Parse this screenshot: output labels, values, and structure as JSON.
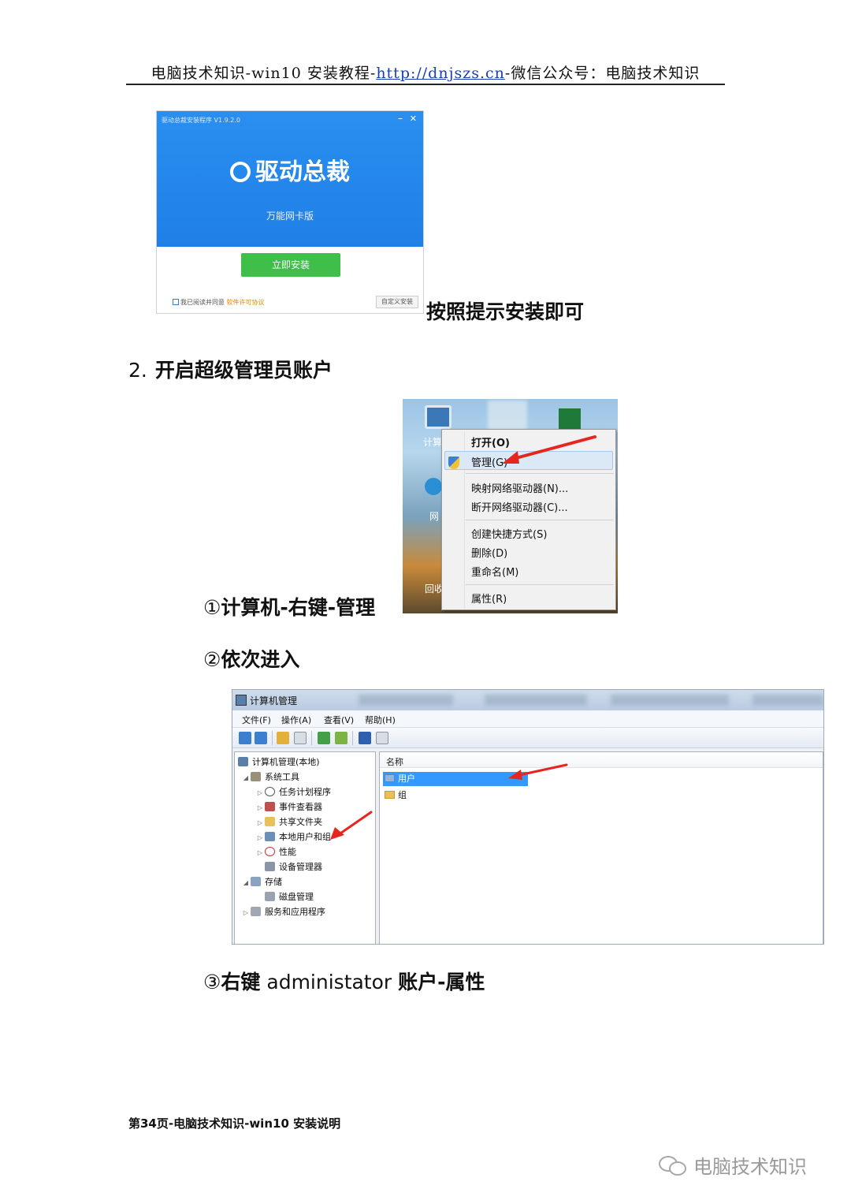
{
  "header": {
    "prefix": "电脑技术知识-win10 安装教程-",
    "link": "http://dnjszs.cn",
    "suffix": "-微信公众号：电脑技术知识"
  },
  "installer": {
    "window_title": "驱动总裁安装程序 V1.9.2.0",
    "brand": "驱动总裁",
    "subtitle": "万能网卡版",
    "install_button": "立即安装",
    "agree_text": "我已阅读并同意",
    "license_link": "软件许可协议",
    "custom_button": "自定义安装"
  },
  "caption_install": "按照提示安装即可",
  "section2": {
    "number": "2.",
    "title": "开启超级管理员账户"
  },
  "context_menu": {
    "desktop_labels": [
      "计算",
      "网",
      "回收"
    ],
    "items": [
      "打开(O)",
      "管理(G)",
      "映射网络驱动器(N)...",
      "断开网络驱动器(C)...",
      "创建快捷方式(S)",
      "删除(D)",
      "重命名(M)",
      "属性(R)"
    ]
  },
  "step1": {
    "marker": "①",
    "text": "计算机-右键-管理"
  },
  "step2": {
    "marker": "②",
    "text": "依次进入"
  },
  "mmc": {
    "title": "计算机管理",
    "menus": [
      "文件(F)",
      "操作(A)",
      "查看(V)",
      "帮助(H)"
    ],
    "tree": {
      "root": "计算机管理(本地)",
      "system_tools": "系统工具",
      "task_scheduler": "任务计划程序",
      "event_viewer": "事件查看器",
      "shared_folders": "共享文件夹",
      "local_users": "本地用户和组",
      "performance": "性能",
      "device_manager": "设备管理器",
      "storage": "存储",
      "disk_management": "磁盘管理",
      "services": "服务和应用程序"
    },
    "column_name": "名称",
    "list": [
      "用户",
      "组"
    ]
  },
  "step3": {
    "marker": "③",
    "bold1": "右键",
    "plain": " administator ",
    "bold2": "账户-属性"
  },
  "footer": "第34页-电脑技术知识-win10 安装说明",
  "watermark": "电脑技术知识"
}
